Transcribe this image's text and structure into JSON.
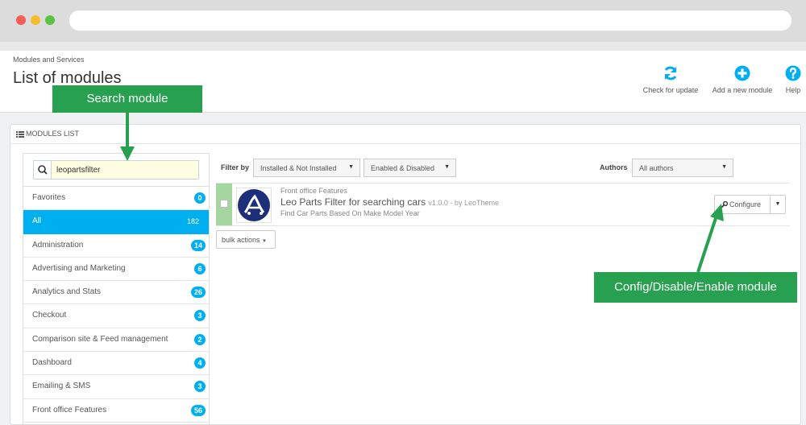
{
  "header": {
    "breadcrumb": "Modules and Services",
    "title": "List of modules",
    "toolbar": {
      "check_update_label": "Check for update",
      "add_module_label": "Add a new module",
      "help_label": "Help"
    }
  },
  "panel": {
    "heading": "MODULES LIST"
  },
  "search": {
    "value": "leopartsfilter"
  },
  "categories": [
    {
      "label": "Favorites",
      "count": "0"
    },
    {
      "label": "All",
      "count": "182"
    },
    {
      "label": "Administration",
      "count": "14"
    },
    {
      "label": "Advertising and Marketing",
      "count": "6"
    },
    {
      "label": "Analytics and Stats",
      "count": "26"
    },
    {
      "label": "Checkout",
      "count": "3"
    },
    {
      "label": "Comparison site & Feed management",
      "count": "2"
    },
    {
      "label": "Dashboard",
      "count": "4"
    },
    {
      "label": "Emailing & SMS",
      "count": "3"
    },
    {
      "label": "Front office Features",
      "count": "56"
    }
  ],
  "filters": {
    "label": "Filter by",
    "install_value": "Installed & Not Installed",
    "enabled_value": "Enabled & Disabled",
    "authors_label": "Authors",
    "authors_value": "All authors"
  },
  "module": {
    "category": "Front office Features",
    "name": "Leo Parts Filter for searching cars",
    "meta": "v1.0.0 - by LeoTheme",
    "description": "Find Car Parts Based On Make Model Year",
    "configure_label": "Configure"
  },
  "bulk_actions_label": "bulk actions",
  "annotations": {
    "search_callout": "Search module",
    "config_callout": "Config/Disable/Enable module"
  },
  "colors": {
    "accent": "#00aff0",
    "callout": "#27a150",
    "module_enabled": "#a5d6a0"
  }
}
